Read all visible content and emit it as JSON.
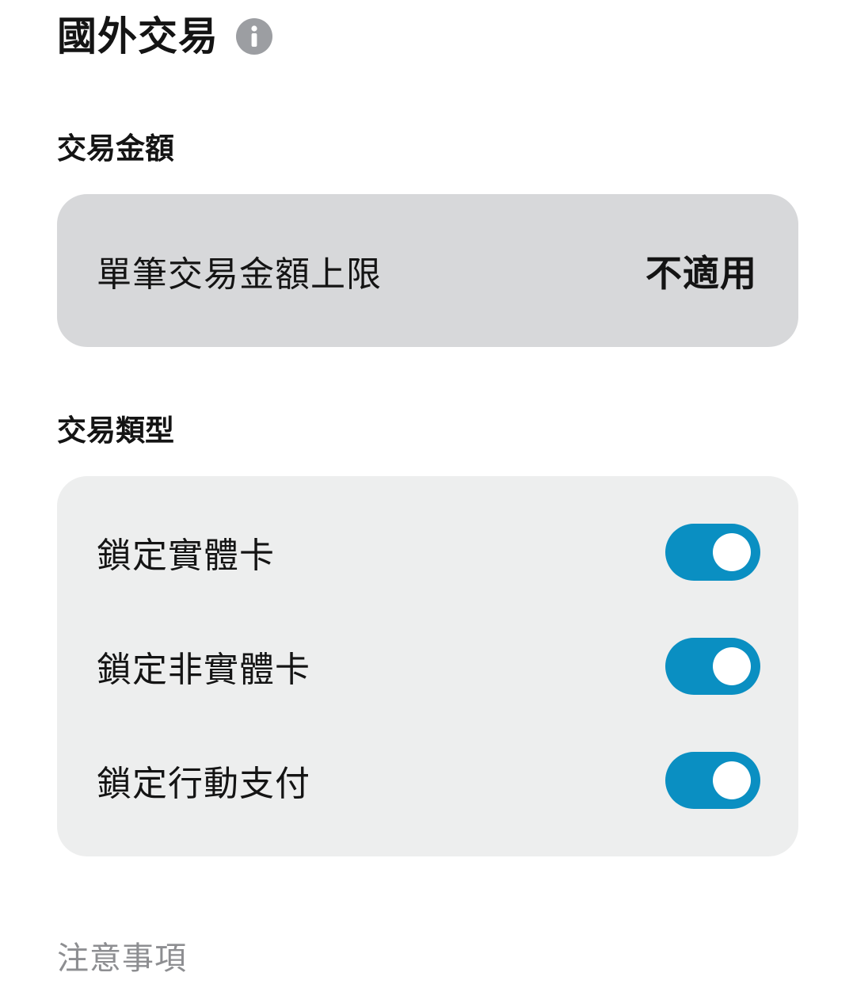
{
  "header": {
    "title": "國外交易",
    "info_icon": "info-icon"
  },
  "amount_section": {
    "heading": "交易金額",
    "rows": [
      {
        "label": "單筆交易金額上限",
        "value": "不適用"
      }
    ]
  },
  "type_section": {
    "heading": "交易類型",
    "toggles": [
      {
        "label": "鎖定實體卡",
        "on": true
      },
      {
        "label": "鎖定非實體卡",
        "on": true
      },
      {
        "label": "鎖定行動支付",
        "on": true
      }
    ]
  },
  "notes": {
    "heading": "注意事項"
  },
  "colors": {
    "toggle_on": "#0a8fc2",
    "amount_card_bg": "#d7d8da",
    "type_card_bg": "#edeeee",
    "info_icon": "#9c9ea2",
    "notes_text": "#8d8e91"
  }
}
